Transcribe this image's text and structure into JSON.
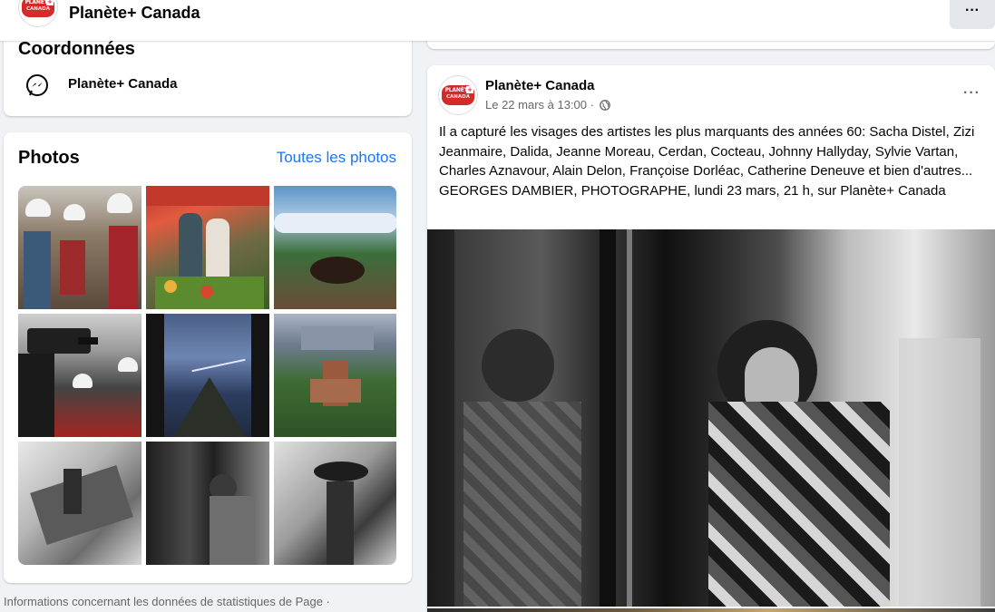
{
  "header": {
    "page_name": "Planète+ Canada",
    "more_label": "···"
  },
  "logo": {
    "line1": "PLANÈTE",
    "line2": "CANADA",
    "plus": "+"
  },
  "contact": {
    "title": "Coordonnées",
    "messenger_name": "Planète+ Canada"
  },
  "photos": {
    "title": "Photos",
    "see_all": "Toutes les photos",
    "items": [
      "Randonneurs casqués en montagne",
      "Marché de fruits et légumes",
      "Cratère volcanique et mer de nuages",
      "Équipe de tournage avec caméra",
      "Orage au-dessus d'un volcan",
      "Monastère dans une forêt urbaine",
      "Photo noir et blanc : femme et voiture",
      "Photo noir et blanc : femme au reflet",
      "Photo noir et blanc : femme au chapeau"
    ]
  },
  "footer": {
    "text": "Informations concernant les données de statistiques de Page ·"
  },
  "post": {
    "author": "Planète+ Canada",
    "date": "Le 22 mars à 13:00 ·",
    "more_label": "···",
    "text": "Il a capturé les visages des artistes les plus marquants des années 60: Sacha Distel, Zizi Jeanmaire, Dalida, Jeanne Moreau, Cerdan, Cocteau, Johnny Hallyday, Sylvie Vartan, Charles Aznavour, Alain Delon, Françoise Dorléac, Catherine Deneuve et bien d'autres... GEORGES DAMBIER, PHOTOGRAPHE, lundi 23 mars, 21 h, sur Planète+ Canada"
  },
  "colors": {
    "link": "#1877f2",
    "brand_red": "#d42a2a",
    "secondary_text": "#65676b",
    "page_bg": "#f0f2f5"
  }
}
